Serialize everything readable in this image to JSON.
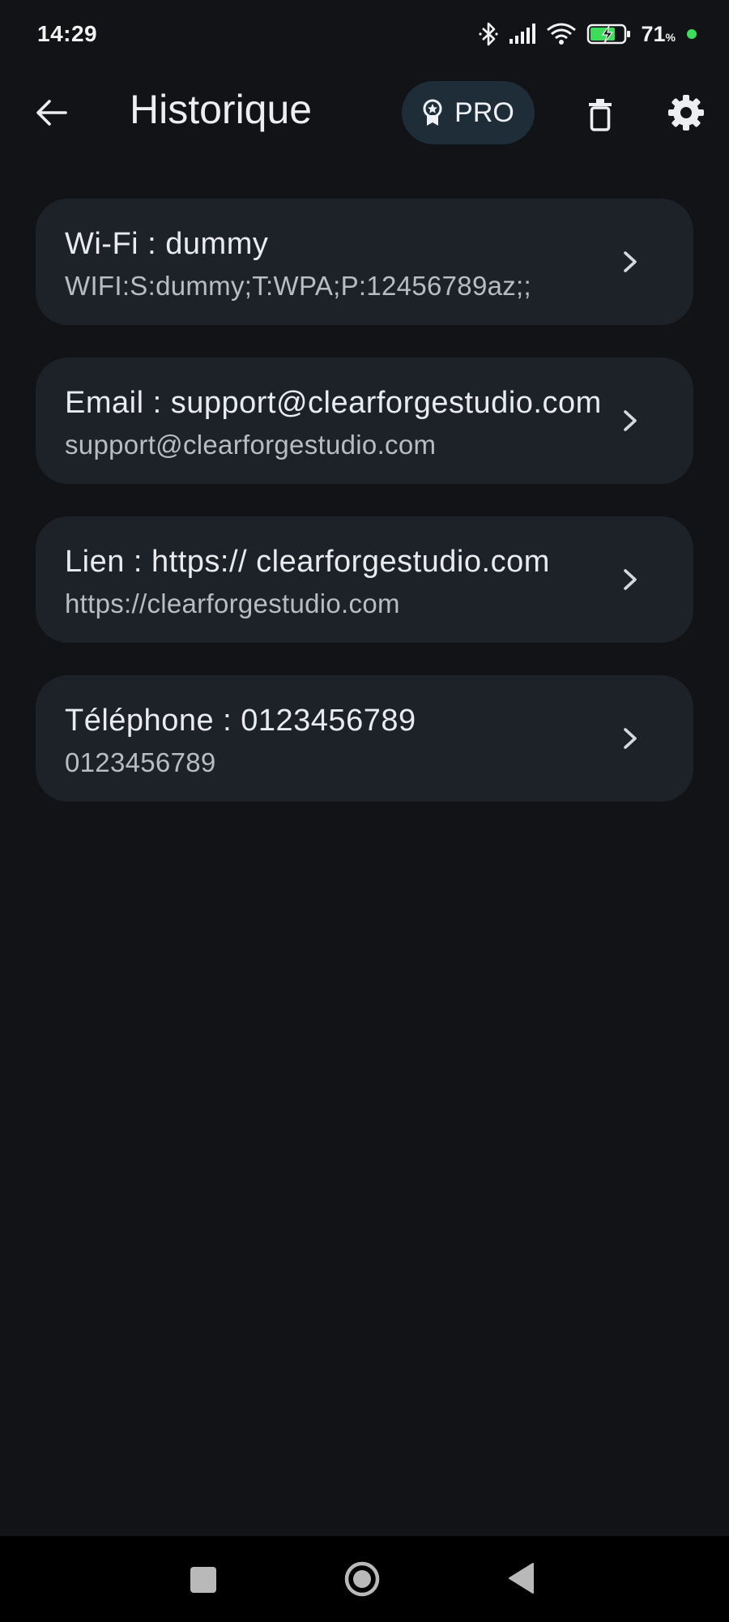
{
  "status": {
    "time": "14:29",
    "battery": "71",
    "battery_unit": "%",
    "icons": [
      "bluetooth-icon",
      "signal-icon",
      "wifi-icon",
      "battery-charging-icon"
    ]
  },
  "appbar": {
    "title": "Historique",
    "pro_label": "PRO",
    "icons": [
      "arrow-back-icon",
      "award-icon",
      "trash-icon",
      "gear-icon"
    ]
  },
  "history": [
    {
      "title": "Wi-Fi : dummy",
      "subtitle": "WIFI:S:dummy;T:WPA;P:12456789az;;"
    },
    {
      "title": "Email : support@clearforgestudio.com",
      "subtitle": "support@clearforgestudio.com"
    },
    {
      "title": "Lien : https:// clearforgestudio.com",
      "subtitle": "https://clearforgestudio.com"
    },
    {
      "title": "Téléphone : 0123456789",
      "subtitle": "0123456789"
    }
  ],
  "navbar": {
    "icons": [
      "recents-icon",
      "home-icon",
      "back-triangle-icon"
    ]
  },
  "colors": {
    "background": "#111317",
    "card": "#1d2128",
    "pro_button": "#1f2d38",
    "battery_dot": "#3ddc5a"
  }
}
